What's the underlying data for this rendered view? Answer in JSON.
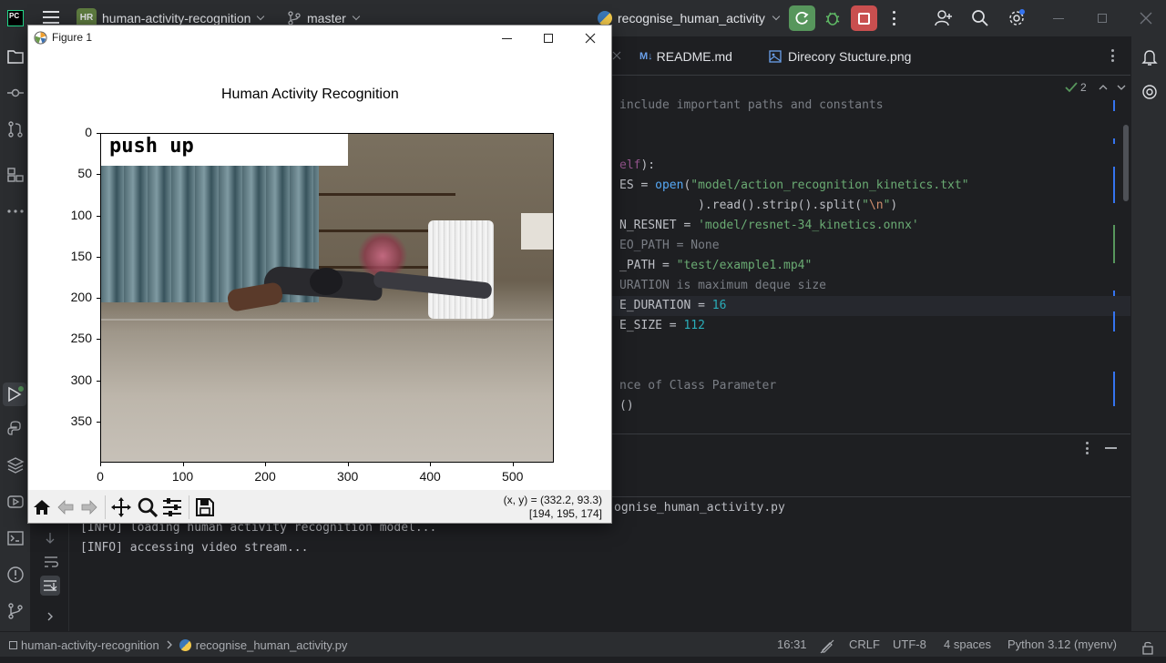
{
  "ide": {
    "logo": "PC",
    "project_badge": "HR",
    "project_name": "human-activity-recognition",
    "branch": "master",
    "run_config": "recognise_human_activity"
  },
  "editor": {
    "tabs": [
      {
        "icon": "M↓",
        "label": "README.md"
      },
      {
        "icon": "image-icon",
        "label": "Direcory Stucture.png"
      }
    ],
    "inspection_count": "2",
    "code": [
      {
        "segments": [
          {
            "t": "include important paths and constants",
            "c": "cmt"
          }
        ]
      },
      {
        "segments": []
      },
      {
        "segments": []
      },
      {
        "segments": [
          {
            "t": "elf",
            "c": "self"
          },
          {
            "t": "):",
            "c": ""
          }
        ]
      },
      {
        "segments": [
          {
            "t": "ES = ",
            "c": ""
          },
          {
            "t": "open",
            "c": "fn"
          },
          {
            "t": "(",
            "c": ""
          },
          {
            "t": "\"model/action_recognition_kinetics.txt\"",
            "c": "str"
          }
        ]
      },
      {
        "segments": [
          {
            "t": "           ).read().strip().split(",
            "c": ""
          },
          {
            "t": "\"",
            "c": "str"
          },
          {
            "t": "\\n",
            "c": "kw"
          },
          {
            "t": "\"",
            "c": "str"
          },
          {
            "t": ")",
            "c": ""
          }
        ]
      },
      {
        "segments": [
          {
            "t": "N_RESNET = ",
            "c": ""
          },
          {
            "t": "'model/resnet-34_kinetics.onnx'",
            "c": "str"
          }
        ]
      },
      {
        "segments": [
          {
            "t": "EO_PATH = None",
            "c": "cmt"
          }
        ]
      },
      {
        "segments": [
          {
            "t": "_PATH = ",
            "c": ""
          },
          {
            "t": "\"test/example1.mp4\"",
            "c": "str"
          }
        ]
      },
      {
        "segments": [
          {
            "t": "URATION is maximum deque size",
            "c": "cmt"
          }
        ]
      },
      {
        "segments": [
          {
            "t": "E_DURATION = ",
            "c": ""
          },
          {
            "t": "16",
            "c": "num"
          }
        ]
      },
      {
        "segments": [
          {
            "t": "E_SIZE = ",
            "c": ""
          },
          {
            "t": "112",
            "c": "num"
          }
        ]
      },
      {
        "segments": []
      },
      {
        "segments": []
      },
      {
        "segments": [
          {
            "t": "nce of Class Parameter",
            "c": "cmt"
          }
        ]
      },
      {
        "segments": [
          {
            "t": "()",
            "c": ""
          }
        ]
      }
    ]
  },
  "console": {
    "command_tail": "ognise_human_activity.py",
    "lines": [
      "[INFO] loading human activity recognition model...",
      "[INFO] accessing video stream..."
    ]
  },
  "statusbar": {
    "project": "human-activity-recognition",
    "file": "recognise_human_activity.py",
    "position": "16:31",
    "line_sep": "CRLF",
    "encoding": "UTF-8",
    "indent": "4 spaces",
    "interpreter": "Python 3.12 (myenv)"
  },
  "figure": {
    "window_title": "Figure 1",
    "plot_title": "Human Activity Recognition",
    "overlay_label": "push up",
    "x_ticks": [
      "0",
      "100",
      "200",
      "300",
      "400",
      "500"
    ],
    "y_ticks": [
      "0",
      "50",
      "100",
      "150",
      "200",
      "250",
      "300",
      "350"
    ],
    "coord_readout": "(x, y) = (332.2, 93.3)",
    "pixel_readout": "[194, 195, 174]"
  }
}
